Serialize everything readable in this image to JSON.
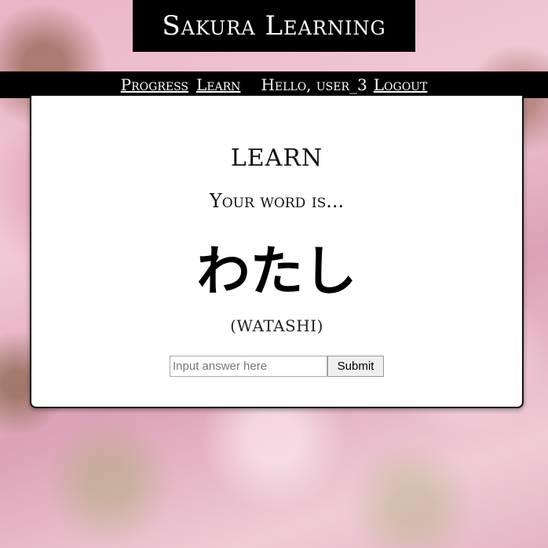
{
  "site": {
    "title": "Sakura Learning"
  },
  "nav": {
    "progress_label": "Progress",
    "learn_label": "Learn",
    "greeting": "Hello, user_3",
    "logout_label": "Logout"
  },
  "card": {
    "title": "LEARN",
    "prompt": "Your word is...",
    "word": "わたし",
    "romaji": "(WATASHI)"
  },
  "form": {
    "answer_placeholder": "Input answer here",
    "answer_value": "",
    "submit_label": "Submit"
  }
}
